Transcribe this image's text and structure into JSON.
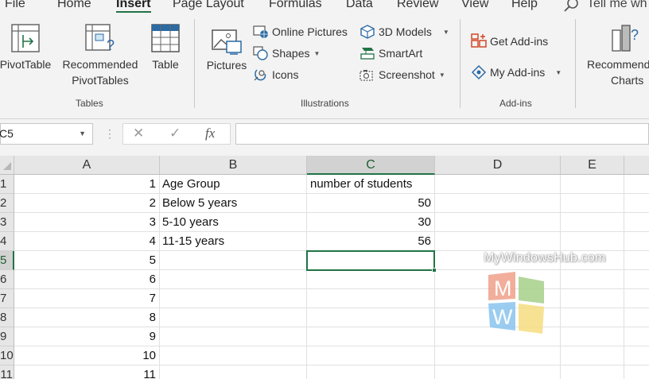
{
  "tabs": [
    {
      "id": "file",
      "label": "File"
    },
    {
      "id": "home",
      "label": "Home"
    },
    {
      "id": "insert",
      "label": "Insert"
    },
    {
      "id": "page-layout",
      "label": "Page Layout"
    },
    {
      "id": "formulas",
      "label": "Formulas"
    },
    {
      "id": "data",
      "label": "Data"
    },
    {
      "id": "review",
      "label": "Review"
    },
    {
      "id": "view",
      "label": "View"
    },
    {
      "id": "help",
      "label": "Help"
    }
  ],
  "active_tab": "Insert",
  "tell_me": "Tell me wh",
  "ribbon": {
    "tables": {
      "label": "Tables",
      "pivottable": "PivotTable",
      "recommended_pivottables_line1": "Recommended",
      "recommended_pivottables_line2": "PivotTables",
      "table": "Table"
    },
    "illustrations": {
      "label": "Illustrations",
      "pictures": "Pictures",
      "online_pictures": "Online Pictures",
      "shapes": "Shapes",
      "icons": "Icons",
      "models_3d": "3D Models",
      "smartart": "SmartArt",
      "screenshot": "Screenshot"
    },
    "addins": {
      "label": "Add-ins",
      "get_addins": "Get Add-ins",
      "my_addins": "My Add-ins"
    },
    "charts": {
      "recommended_line1": "Recommend",
      "recommended_line2": "Charts"
    }
  },
  "formula_bar": {
    "name_box": "C5",
    "fx": "fx",
    "content": ""
  },
  "columns": [
    "A",
    "B",
    "C",
    "D",
    "E"
  ],
  "selected_column": "C",
  "rows": [
    "1",
    "2",
    "3",
    "4",
    "5",
    "6",
    "7",
    "8",
    "9",
    "10",
    "11"
  ],
  "selected_row": "5",
  "sheet": {
    "col_a": [
      "1",
      "2",
      "3",
      "4",
      "5",
      "6",
      "7",
      "8",
      "9",
      "10",
      "11"
    ],
    "col_b": [
      "Age Group",
      "Below 5 years",
      "5-10 years",
      "11-15 years"
    ],
    "col_c": [
      "number of students",
      "50",
      "30",
      "56"
    ]
  },
  "watermark": {
    "text": "MyWindowsHub.com",
    "letter_top": "M",
    "letter_bottom": "W"
  },
  "colors": {
    "excel_green": "#217346",
    "ribbon_bg": "#f3f3f3",
    "header_bg": "#e6e6e6"
  }
}
